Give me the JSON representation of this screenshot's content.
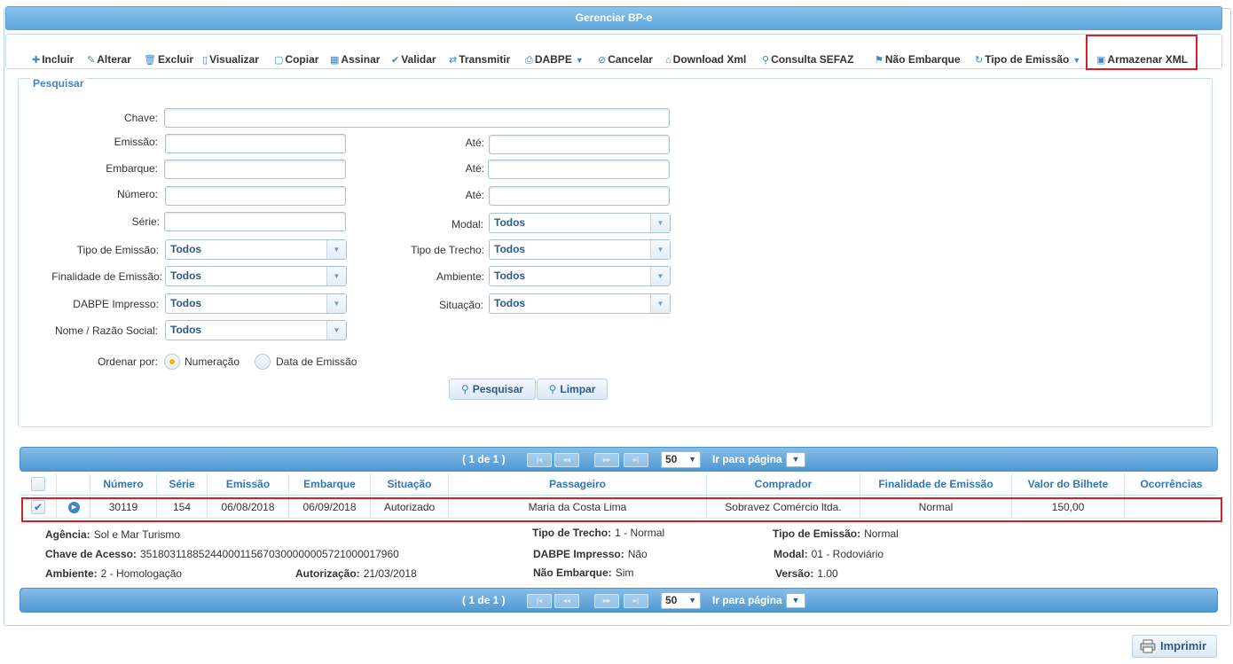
{
  "panel": {
    "title": "Gerenciar BP-e"
  },
  "toolbar": {
    "incluir": "Incluir",
    "alterar": "Alterar",
    "excluir": "Excluir",
    "visualizar": "Visualizar",
    "copiar": "Copiar",
    "assinar": "Assinar",
    "validar": "Validar",
    "transmitir": "Transmitir",
    "dabpe": "DABPE",
    "cancelar": "Cancelar",
    "download_xml": "Download Xml",
    "consulta_sefaz": "Consulta SEFAZ",
    "nao_embarque": "Não Embarque",
    "tipo_emissao": "Tipo de Emissão",
    "armazenar_xml": "Armazenar XML"
  },
  "search": {
    "legend": "Pesquisar",
    "labels": {
      "chave": "Chave:",
      "emissao": "Emissão:",
      "ate1": "Até:",
      "embarque": "Embarque:",
      "ate2": "Até:",
      "numero": "Número:",
      "ate3": "Até:",
      "serie": "Série:",
      "modal": "Modal:",
      "tipo_emissao": "Tipo de Emissão:",
      "tipo_trecho": "Tipo de Trecho:",
      "finalidade": "Finalidade de Emissão:",
      "ambiente": "Ambiente:",
      "dabpe_impresso": "DABPE Impresso:",
      "situacao": "Situação:",
      "nome_razao": "Nome / Razão Social:",
      "ordenar": "Ordenar por:"
    },
    "values": {
      "chave": "",
      "emissao": "",
      "emissao_ate": "",
      "embarque": "",
      "embarque_ate": "",
      "numero": "",
      "numero_ate": "",
      "serie": ""
    },
    "selects": {
      "modal": "Todos",
      "tipo_emissao": "Todos",
      "tipo_trecho": "Todos",
      "finalidade": "Todos",
      "ambiente": "Todos",
      "dabpe_impresso": "Todos",
      "situacao": "Todos",
      "nome_razao": "Todos"
    },
    "order_options": [
      "Numeração",
      "Data de Emissão"
    ],
    "order_selected": "Numeração",
    "btn_pesquisar": "Pesquisar",
    "btn_limpar": "Limpar"
  },
  "pager": {
    "info": "( 1 de 1 )",
    "page_size": "50",
    "goto_label": "Ir para página"
  },
  "table": {
    "headers": [
      "Número",
      "Série",
      "Emissão",
      "Embarque",
      "Situação",
      "Passageiro",
      "Comprador",
      "Finalidade de Emissão",
      "Valor do Bilhete",
      "Ocorrências"
    ],
    "rows": [
      [
        "30119",
        "154",
        "06/08/2018",
        "06/09/2018",
        "Autorizado",
        "Maria da Costa Lima",
        "Sobravez Comércio ltda.",
        "Normal",
        "150,00",
        ""
      ]
    ]
  },
  "details": {
    "agencia_label": "Agência:",
    "agencia": "Sol e Mar Turismo",
    "tipo_trecho_label": "Tipo de Trecho:",
    "tipo_trecho": "1 - Normal",
    "tipo_emissao_label": "Tipo de Emissão:",
    "tipo_emissao": "Normal",
    "chave_label": "Chave de Acesso:",
    "chave": "35180311885244000115670300000005721000017960",
    "dabpe_label": "DABPE Impresso:",
    "dabpe": "Não",
    "modal_label": "Modal:",
    "modal": "01 - Rodoviário",
    "ambiente_label": "Ambiente:",
    "ambiente": "2 - Homologação",
    "autorizacao_label": "Autorização:",
    "autorizacao": "21/03/2018",
    "nao_embarque_label": "Não Embarque:",
    "nao_embarque": "Sim",
    "versao_label": "Versão:",
    "versao": "1.00"
  },
  "print": {
    "label": "Imprimir"
  }
}
